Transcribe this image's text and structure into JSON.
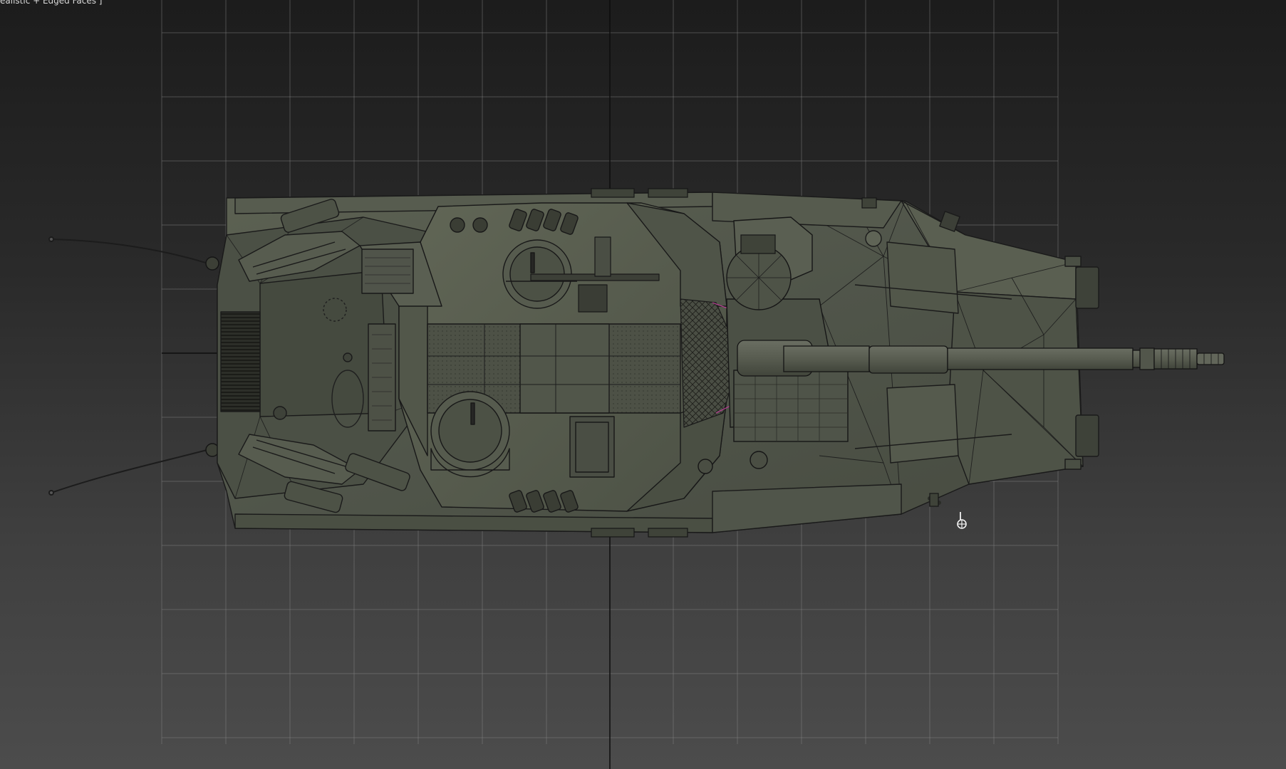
{
  "viewport": {
    "label": "ealistic + Edged Faces ]",
    "grid": {
      "visible": true,
      "color": "#8a8a8a",
      "axis_color": "#0d0d0d"
    },
    "background": {
      "top_color": "#1c1c1c",
      "bottom_color": "#4c4c4c"
    }
  },
  "model": {
    "object": "tank-top-view",
    "display_mode": "Realistic + Edged Faces",
    "base_color": "#555a4c",
    "edge_color": "#1a1a1a",
    "selection_highlight_color": "#c03c9a"
  },
  "icons": {
    "gizmo": "transform-gizmo-icon"
  }
}
